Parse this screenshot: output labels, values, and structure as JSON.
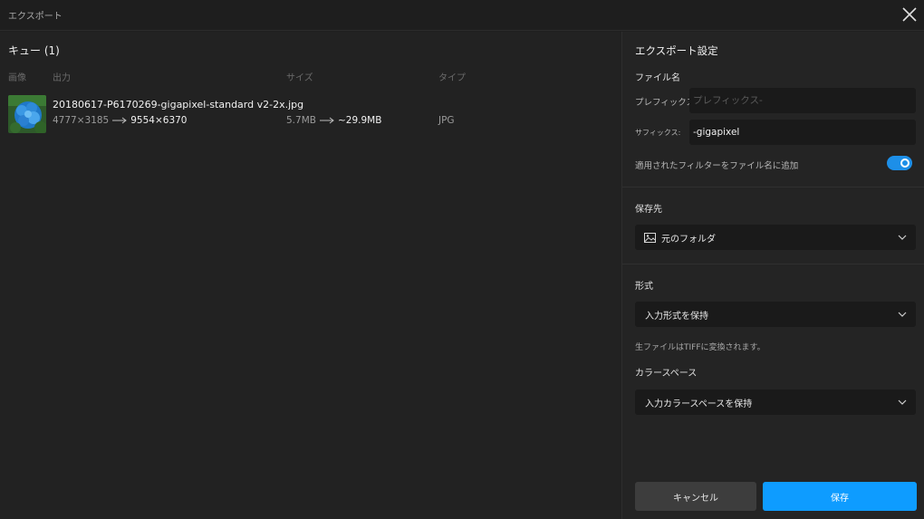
{
  "window": {
    "title": "エクスポート"
  },
  "queue": {
    "title": "キュー (1)",
    "columns": {
      "image": "画像",
      "output": "出力",
      "size": "サイズ",
      "type": "タイプ"
    },
    "items": [
      {
        "filename": "20180617-P6170269-gigapixel-standard v2-2x.jpg",
        "dim_in": "4777×3185",
        "dim_out": "9554×6370",
        "size_in": "5.7MB",
        "size_out": "~29.9MB",
        "type": "JPG"
      }
    ]
  },
  "settings": {
    "title": "エクスポート設定",
    "filename_section": "ファイル名",
    "prefix_label": "プレフィックス:",
    "prefix_placeholder": "プレフィックス-",
    "prefix_value": "",
    "suffix_label": "サフィックス:",
    "suffix_value": "-gigapixel",
    "append_filters_label": "適用されたフィルターをファイル名に追加",
    "append_filters_on": true,
    "destination_title": "保存先",
    "destination_value": "元のフォルダ",
    "format_title": "形式",
    "format_value": "入力形式を保持",
    "raw_note": "生ファイルはTIFFに変換されます。",
    "colorspace_title": "カラースペース",
    "colorspace_value": "入力カラースペースを保持"
  },
  "actions": {
    "cancel_label": "キャンセル",
    "save_label": "保存"
  },
  "colors": {
    "accent": "#0e9cff",
    "toggle": "#1d8fe8",
    "background": "#202020"
  },
  "icons": [
    "close-icon",
    "arrow-right-icon",
    "folder-image-icon",
    "chevron-down-icon"
  ]
}
